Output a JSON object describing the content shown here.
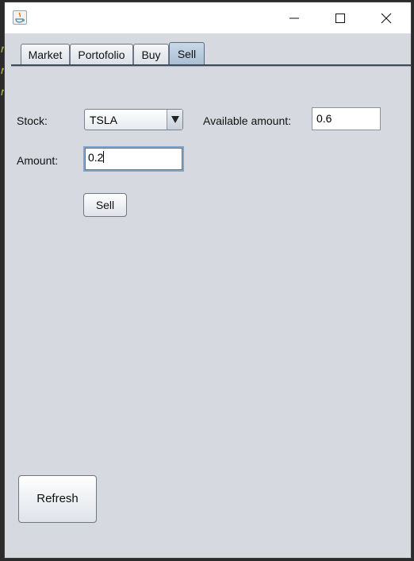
{
  "window": {
    "title": ""
  },
  "tabs": [
    {
      "label": "Market",
      "active": false
    },
    {
      "label": "Portofolio",
      "active": false
    },
    {
      "label": "Buy",
      "active": false
    },
    {
      "label": "Sell",
      "active": true
    }
  ],
  "sell_form": {
    "stock_label": "Stock:",
    "stock_selected": "TSLA",
    "available_label": "Available amount:",
    "available_value": "0.6",
    "amount_label": "Amount:",
    "amount_value": "0.2",
    "sell_button": "Sell"
  },
  "refresh_button": "Refresh",
  "colors": {
    "panel_bg": "#d6d9df",
    "active_tab": "#b8cadb",
    "focus_border": "#7fa6cf"
  },
  "icons": [
    "java-app-icon",
    "minimize-icon",
    "maximize-icon",
    "close-icon",
    "dropdown-arrow-icon"
  ]
}
